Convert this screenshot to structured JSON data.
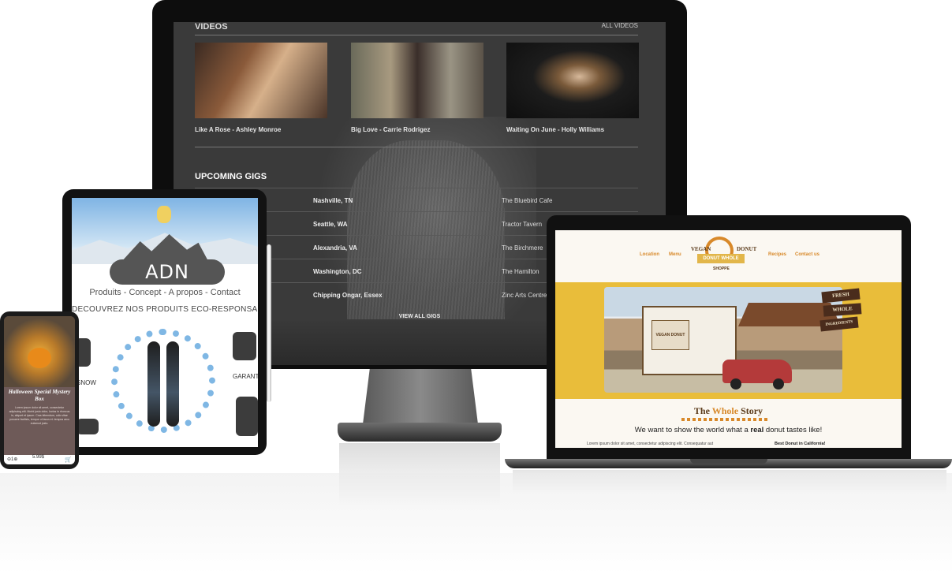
{
  "monitor": {
    "videos_heading": "VIDEOS",
    "all_videos_link": "ALL VIDEOS",
    "videos": [
      {
        "title": "Like A Rose - Ashley Monroe"
      },
      {
        "title": "Big Love - Carrie Rodrigez"
      },
      {
        "title": "Waiting On June - Holly Williams"
      }
    ],
    "gigs_heading": "UPCOMING GIGS",
    "gigs": [
      {
        "city": "Nashville, TN",
        "venue": "The Bluebird Cafe"
      },
      {
        "city": "Seattle, WA",
        "venue": "Tractor Tavern"
      },
      {
        "city": "Alexandria, VA",
        "venue": "The Birchmere"
      },
      {
        "city": "Washington, DC",
        "venue": "The Hamilton"
      },
      {
        "city": "Chipping Ongar, Essex",
        "venue": "Zinc Arts Centre"
      }
    ],
    "view_all_gigs": "VIEW ALL GIGS"
  },
  "laptop": {
    "nav_left": [
      "Location",
      "Menu"
    ],
    "nav_right": [
      "Recipes",
      "Contact us"
    ],
    "logo_left": "VEGAN",
    "logo_right": "DONUT",
    "logo_ribbon": "DONUT WHOLE",
    "logo_sub": "SHOPPE",
    "sign_text": "VEGAN DONUT",
    "banners": [
      "FRESH",
      "WHOLE",
      "INGREDIENTS"
    ],
    "story_prefix": "The ",
    "story_word": "Whole",
    "story_suffix": " Story",
    "tagline_pre": "We want to show the world what a ",
    "tagline_bold": "real",
    "tagline_post": " donut tastes like!",
    "lorem": "Lorem ipsum dolor sit amet, consectetur adipiscing elit. Consequatur aut",
    "best": "Best Donut in California!"
  },
  "tablet": {
    "brand": "ADN",
    "nav": "Produits - Concept - A propos - Contact",
    "subtitle": "DECOUVREZ NOS PRODUITS ECO-RESPONSABLES",
    "side_left": "SNOW",
    "side_right": "GARANTI"
  },
  "phone": {
    "title": "Halloween Special Mystery Box",
    "lorem": "Lorem ipsum dolor sit amet, consectetur adipiscing elit. Morbi justo dolor, luctus in rhoncus in, aliquet et ipsum. Cras bibendum, odio vitae posuere facilisis, tempor ut lacus et. tempus arcu euismod justo.",
    "qty": "1",
    "price": "5.99$"
  },
  "colors": {
    "monitor_bg": "#3a3a3a",
    "donut_orange": "#d8892a",
    "donut_yellow": "#e9bd3a",
    "adn_gray": "#555555",
    "phone_bg": "#6e5a58"
  }
}
